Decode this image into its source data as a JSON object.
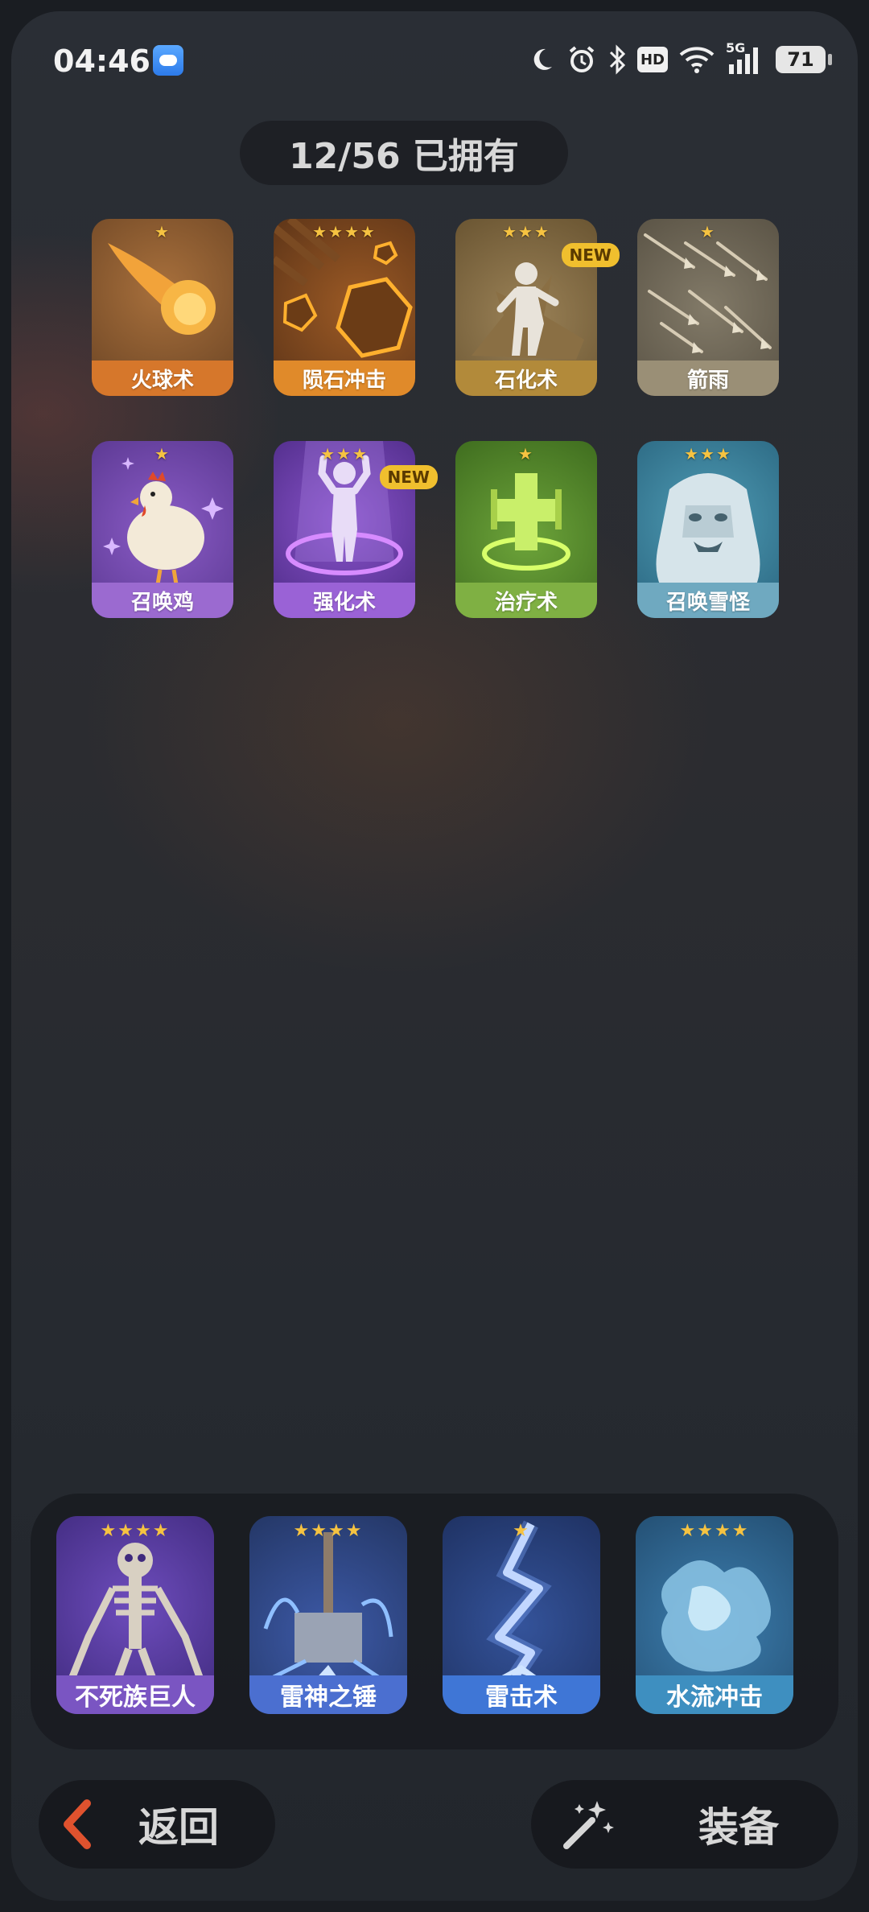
{
  "status_bar": {
    "time": "04:46",
    "network": "5G",
    "hd": "HD",
    "battery": "71"
  },
  "header": {
    "owned_text": "12/56 已拥有"
  },
  "skills": [
    {
      "name": "火球术",
      "stars": "★",
      "new": ""
    },
    {
      "name": "陨石冲击",
      "stars": "★★★★",
      "new": ""
    },
    {
      "name": "石化术",
      "stars": "★★★",
      "new": "NEW"
    },
    {
      "name": "箭雨",
      "stars": "★",
      "new": ""
    },
    {
      "name": "召唤鸡",
      "stars": "★",
      "new": ""
    },
    {
      "name": "强化术",
      "stars": "★★★",
      "new": "NEW"
    },
    {
      "name": "治疗术",
      "stars": "★",
      "new": ""
    },
    {
      "name": "召唤雪怪",
      "stars": "★★★",
      "new": ""
    }
  ],
  "equipped": [
    {
      "name": "不死族巨人",
      "stars": "★★★★"
    },
    {
      "name": "雷神之锤",
      "stars": "★★★★"
    },
    {
      "name": "雷击术",
      "stars": "★"
    },
    {
      "name": "水流冲击",
      "stars": "★★★★"
    }
  ],
  "footer": {
    "back_label": "返回",
    "equip_label": "装备"
  },
  "colors": {
    "fire": "#d87a2c",
    "meteor": "#e08a2a",
    "stone": "#b28a3a",
    "arrow": "#9a8f76",
    "chicken": "#9b6ad0",
    "buff": "#9a62d6",
    "heal": "#7fb043",
    "yeti": "#6fa9c0",
    "skeleton": "#7a55c2",
    "hammer": "#4b6fd0",
    "lightning": "#3f76d6",
    "water": "#3e8fc0",
    "star": "#f6c341",
    "new_badge": "#f0bf2e"
  },
  "icons": [
    "moon-icon",
    "alarm-icon",
    "bluetooth-icon",
    "hd-icon",
    "wifi-icon",
    "signal-icon",
    "battery-icon",
    "weather-icon",
    "back-chevron-icon",
    "magic-wand-icon"
  ]
}
